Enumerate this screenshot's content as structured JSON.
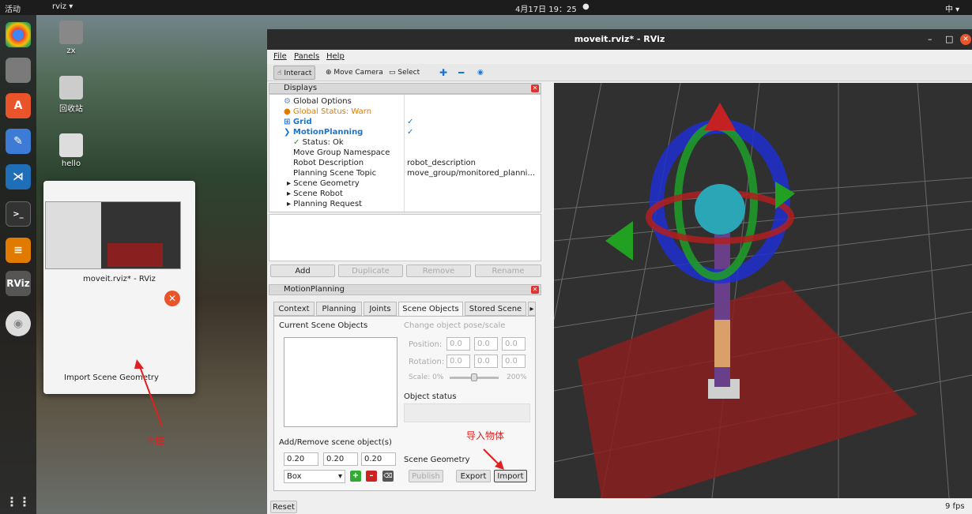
{
  "topbar": {
    "activities": "活动",
    "app": "rviz ▾",
    "clock": "4月17日 19：25",
    "ime": "中 ▾"
  },
  "desktop": {
    "icons": [
      {
        "label": "zx"
      },
      {
        "label": "回收站"
      },
      {
        "label": "hello"
      }
    ]
  },
  "dock": {
    "rviz_label": "RViz"
  },
  "popup": {
    "title": "moveit.rviz* - RViz",
    "subtitle": "Import Scene Geometry"
  },
  "annotations": {
    "stuck": "卡住",
    "import_obj": "导入物体"
  },
  "window": {
    "title": "moveit.rviz* - RViz"
  },
  "menu": {
    "file": "File",
    "panels": "Panels",
    "help": "Help"
  },
  "toolbar": {
    "interact": "Interact",
    "move_camera": "Move Camera",
    "select": "Select"
  },
  "displays": {
    "header": "Displays",
    "items": [
      {
        "label": "Global Options",
        "value": ""
      },
      {
        "label": "Global Status: Warn",
        "value": ""
      },
      {
        "label": "Grid",
        "value": "✓"
      },
      {
        "label": "MotionPlanning",
        "value": "✓"
      },
      {
        "label": "Status: Ok",
        "value": ""
      },
      {
        "label": "Move Group Namespace",
        "value": ""
      },
      {
        "label": "Robot Description",
        "value": "robot_description"
      },
      {
        "label": "Planning Scene Topic",
        "value": "move_group/monitored_planni..."
      },
      {
        "label": "Scene Geometry",
        "value": ""
      },
      {
        "label": "Scene Robot",
        "value": ""
      },
      {
        "label": "Planning Request",
        "value": ""
      }
    ],
    "buttons": {
      "add": "Add",
      "duplicate": "Duplicate",
      "remove": "Remove",
      "rename": "Rename"
    }
  },
  "motion": {
    "header": "MotionPlanning",
    "tabs": [
      "Context",
      "Planning",
      "Joints",
      "Scene Objects",
      "Stored Scene"
    ],
    "current_objects": "Current Scene Objects",
    "change_pose": "Change object pose/scale",
    "position": "Position:",
    "rotation": "Rotation:",
    "scale_label": "Scale: 0%",
    "scale_max": "200%",
    "pos_vals": [
      "0.0",
      "0.0",
      "0.0"
    ],
    "rot_vals": [
      "0.0",
      "0.0",
      "0.0"
    ],
    "object_status": "Object status",
    "add_remove": "Add/Remove scene object(s)",
    "dims": [
      "0.20",
      "0.20",
      "0.20"
    ],
    "shape": "Box",
    "scene_geometry": "Scene Geometry",
    "publish": "Publish",
    "export": "Export",
    "import": "Import"
  },
  "statusbar": {
    "reset": "Reset",
    "fps": "9 fps"
  },
  "colors": {
    "accent": "#e9542b",
    "link": "#1b74d1",
    "warn": "#e07b00"
  }
}
